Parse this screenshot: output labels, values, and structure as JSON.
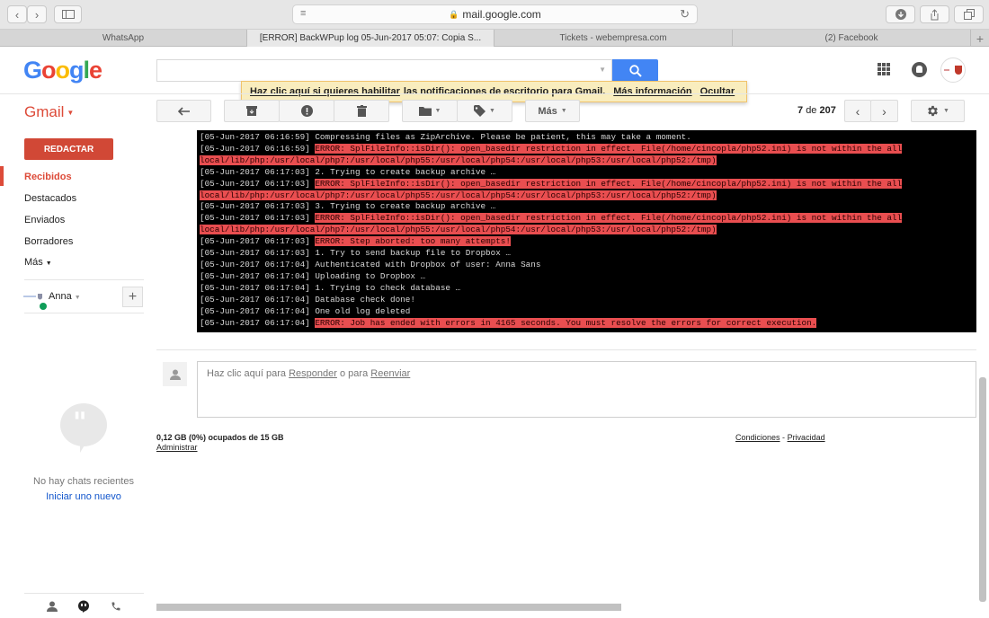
{
  "browser": {
    "url": "mail.google.com",
    "tabs": [
      {
        "label": "WhatsApp"
      },
      {
        "label": "[ERROR] BackWPup log 05-Jun-2017 05:07: Copia S..."
      },
      {
        "label": "Tickets - webempresa.com"
      },
      {
        "label": "(2) Facebook"
      }
    ]
  },
  "header": {
    "logo": "Google",
    "search_placeholder": ""
  },
  "notification": {
    "enable_link": "Haz clic aquí si quieres habilitar",
    "text": "las notificaciones de escritorio para Gmail.",
    "more_info": "Más información",
    "hide": "Ocultar"
  },
  "toolbar": {
    "gmail_label": "Gmail",
    "more_label": "Más",
    "counter_current": "7",
    "counter_sep": "de",
    "counter_total": "207"
  },
  "sidebar": {
    "compose": "REDACTAR",
    "items": [
      {
        "label": "Recibidos",
        "active": true
      },
      {
        "label": "Destacados"
      },
      {
        "label": "Enviados"
      },
      {
        "label": "Borradores"
      },
      {
        "label": "Más"
      }
    ],
    "user_name": "Anna",
    "no_chats": "No hay chats recientes",
    "new_chat": "Iniciar uno nuevo"
  },
  "log_lines": [
    {
      "ts": "[05-Jun-2017 06:16:59]",
      "msg": "Compressing files as ZipArchive. Please be patient, this may take a moment.",
      "err": false
    },
    {
      "ts": "[05-Jun-2017 06:16:59]",
      "msg": "ERROR: SplFileInfo::isDir(): open_basedir restriction in effect. File(/home/cincopla/php52.ini) is not within the all",
      "err": true
    },
    {
      "ts": "",
      "msg": "local/lib/php:/usr/local/php7:/usr/local/php55:/usr/local/php54:/usr/local/php53:/usr/local/php52:/tmp)",
      "err": true
    },
    {
      "ts": "[05-Jun-2017 06:17:03]",
      "msg": "2. Trying to create backup archive …",
      "err": false
    },
    {
      "ts": "[05-Jun-2017 06:17:03]",
      "msg": "ERROR: SplFileInfo::isDir(): open_basedir restriction in effect. File(/home/cincopla/php52.ini) is not within the all",
      "err": true
    },
    {
      "ts": "",
      "msg": "local/lib/php:/usr/local/php7:/usr/local/php55:/usr/local/php54:/usr/local/php53:/usr/local/php52:/tmp)",
      "err": true
    },
    {
      "ts": "[05-Jun-2017 06:17:03]",
      "msg": "3. Trying to create backup archive …",
      "err": false
    },
    {
      "ts": "[05-Jun-2017 06:17:03]",
      "msg": "ERROR: SplFileInfo::isDir(): open_basedir restriction in effect. File(/home/cincopla/php52.ini) is not within the all",
      "err": true
    },
    {
      "ts": "",
      "msg": "local/lib/php:/usr/local/php7:/usr/local/php55:/usr/local/php54:/usr/local/php53:/usr/local/php52:/tmp)",
      "err": true
    },
    {
      "ts": "[05-Jun-2017 06:17:03]",
      "msg": "ERROR: Step aborted: too many attempts!",
      "err": true
    },
    {
      "ts": "[05-Jun-2017 06:17:03]",
      "msg": "1. Try to send backup file to Dropbox …",
      "err": false
    },
    {
      "ts": "[05-Jun-2017 06:17:04]",
      "msg": "Authenticated with Dropbox of user: Anna Sans",
      "err": false
    },
    {
      "ts": "[05-Jun-2017 06:17:04]",
      "msg": "Uploading to Dropbox …",
      "err": false
    },
    {
      "ts": "[05-Jun-2017 06:17:04]",
      "msg": "1. Trying to check database …",
      "err": false
    },
    {
      "ts": "[05-Jun-2017 06:17:04]",
      "msg": "Database check done!",
      "err": false
    },
    {
      "ts": "[05-Jun-2017 06:17:04]",
      "msg": "One old log deleted",
      "err": false
    },
    {
      "ts": "[05-Jun-2017 06:17:04]",
      "msg": "ERROR: Job has ended with errors in 4165 seconds. You must resolve the errors for correct execution.",
      "err": true
    }
  ],
  "reply": {
    "prefix": "Haz clic aquí para",
    "reply_link": "Responder",
    "middle": "o para",
    "forward_link": "Reenviar"
  },
  "footer": {
    "storage": "0,12 GB (0%) ocupados de 15 GB",
    "admin": "Administrar",
    "terms": "Condiciones",
    "sep": "-",
    "privacy": "Privacidad"
  },
  "colors": {
    "gmail_red": "#dd4b39",
    "compose_red": "#d14836",
    "search_blue": "#4285f4",
    "error_bg": "#e94e50"
  }
}
